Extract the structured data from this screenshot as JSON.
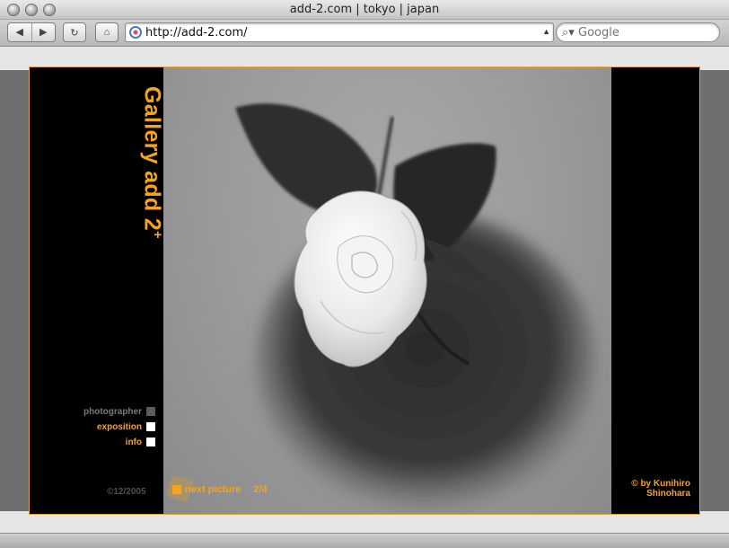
{
  "window": {
    "title": "add-2.com | tokyo | japan"
  },
  "toolbar": {
    "back_icon": "back-arrow-icon",
    "forward_icon": "forward-arrow-icon",
    "reload_icon": "reload-icon",
    "home_icon": "home-icon",
    "url": "http://add-2.com/",
    "search_placeholder": "Google"
  },
  "site": {
    "title_main": "Gallery add 2",
    "title_sup": "+",
    "menu": [
      {
        "label": "photographer",
        "state": "inactive"
      },
      {
        "label": "exposition",
        "state": "active"
      },
      {
        "label": "info",
        "state": "active"
      }
    ],
    "copyright_date": "©12/2005",
    "next_label": "next picture",
    "picture_count": "2/4",
    "credit_line1": "© by Kunihiro",
    "credit_line2": "Shinohara",
    "photo_subject": "white-rose-photo"
  },
  "colors": {
    "accent": "#f5a41c",
    "panel": "#000000",
    "band": "#6f6f6f"
  }
}
